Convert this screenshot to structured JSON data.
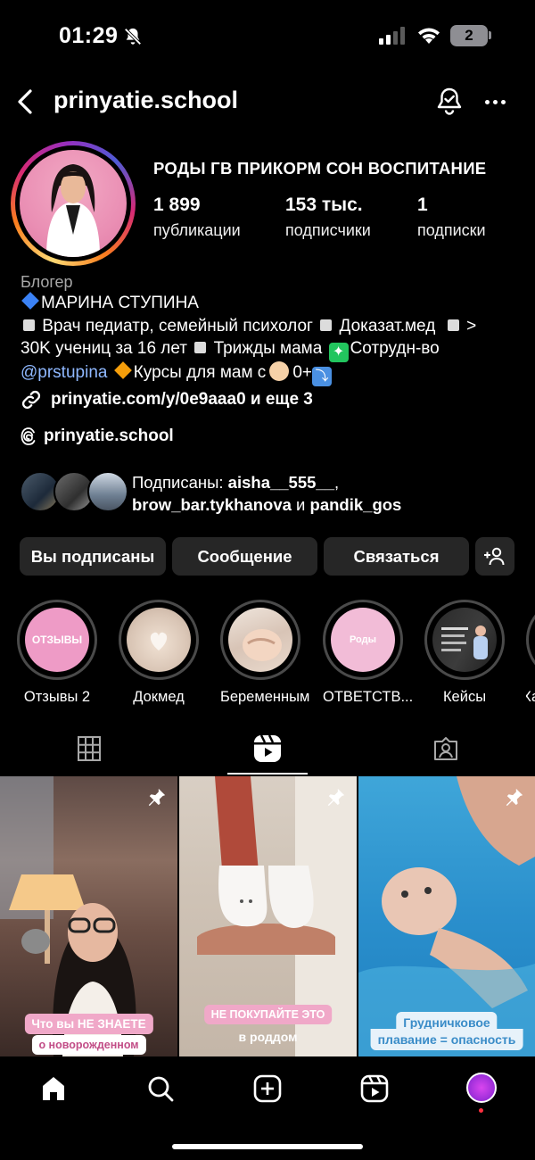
{
  "status_bar": {
    "time": "01:29",
    "battery": "2"
  },
  "header": {
    "username": "prinyatie.school"
  },
  "profile": {
    "title": "РОДЫ ГВ ПРИКОРМ СОН ВОСПИТАНИЕ",
    "stats": [
      {
        "value": "1 899",
        "label": "публикации"
      },
      {
        "value": "153 тыс.",
        "label": "подписчики"
      },
      {
        "value": "1",
        "label": "подписки"
      }
    ],
    "category": "Блогер",
    "bio": {
      "name": "МАРИНА СТУПИНА",
      "line2_a": "Врач педиатр, семейный психолог",
      "line2_b": "Доказат.мед",
      "line2_c": ">",
      "line3_a": "30K учениц за 16 лет",
      "line3_b": "Трижды мама",
      "line3_c": "Сотрудн-во",
      "mention": "@prstupina",
      "line4_a": "Курсы для мам с",
      "line4_b": "0+"
    },
    "link": "prinyatie.com/y/0e9aaa0 и еще 3",
    "threads": "prinyatie.school",
    "followed_by": {
      "prefix": "Подписаны: ",
      "user1": "aisha__555__",
      "comma": ",",
      "user2": "brow_bar.tykhanova",
      "and": " и ",
      "user3": "pandik_gos"
    }
  },
  "buttons": {
    "following": "Вы подписаны",
    "message": "Сообщение",
    "contact": "Связаться"
  },
  "highlights": [
    {
      "label": "Отзывы 2",
      "cover_text": "ОТЗЫВЫ"
    },
    {
      "label": "Докмед"
    },
    {
      "label": "Беременным"
    },
    {
      "label": "ОТВЕТСТВ...",
      "cover_text": "Роды"
    },
    {
      "label": "Кейсы"
    },
    {
      "label": "Ха"
    }
  ],
  "posts": [
    {
      "caption_1": "Что вы НЕ ЗНАЕТЕ",
      "caption_2": "о новорожденном"
    },
    {
      "caption_1": "НЕ ПОКУПАЙТЕ ЭТО",
      "caption_2": "в роддом"
    },
    {
      "caption_1": "Грудничковое",
      "caption_2": "плавание = опасность"
    }
  ],
  "colors": {
    "background": "#000000",
    "button_bg": "#262626",
    "mention": "#8fb8ff"
  },
  "icons": [
    "bell-off-icon",
    "signal-icon",
    "wifi-icon",
    "back-icon",
    "notification-bell-icon",
    "more-icon",
    "link-icon",
    "threads-icon",
    "add-person-icon",
    "grid-icon",
    "reels-icon",
    "tagged-icon",
    "pin-icon",
    "home-icon",
    "search-icon",
    "create-icon",
    "reels-nav-icon"
  ]
}
